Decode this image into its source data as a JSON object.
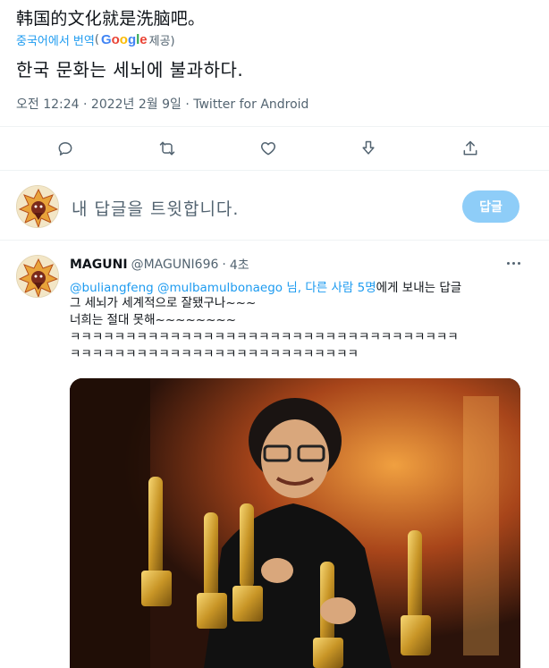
{
  "tweet": {
    "original_text": "韩国的文化就是洗脑吧。",
    "translate": {
      "link_label": "중국어에서 번역",
      "paren_open": "(",
      "google": [
        "G",
        "o",
        "o",
        "g",
        "l",
        "e"
      ],
      "suffix": " 제공)"
    },
    "translated_text": "한국 문화는 세뇌에 불과하다.",
    "meta": "오전 12:24 · 2022년 2월 9일 · Twitter for Android",
    "actions": [
      "reply-icon",
      "retweet-icon",
      "like-icon",
      "download-icon",
      "share-icon"
    ]
  },
  "reply_box": {
    "placeholder": "내 답글을 트윗합니다.",
    "button_label": "답글"
  },
  "reply_tweet": {
    "name": "MAGUNI",
    "handle": "@MAGUNI696",
    "dot": "·",
    "time": "4초",
    "replying_mentions": "@buliangfeng @mulbamulbonaego",
    "replying_others": "님, 다른 사람 5명",
    "replying_suffix": "에게 보내는 답글",
    "body": "그 세뇌가 세계적으로 잘됐구나~~~\n너희는 절대 못해~~~~~~~~\nㅋㅋㅋㅋㅋㅋㅋㅋㅋㅋㅋㅋㅋㅋㅋㅋㅋㅋㅋㅋㅋㅋㅋㅋㅋㅋㅋㅋㅋㅋㅋㅋㅋㅋㅋ\nㅋㅋㅋㅋㅋㅋㅋㅋㅋㅋㅋㅋㅋㅋㅋㅋㅋㅋㅋㅋㅋㅋㅋㅋㅋㅋ"
  },
  "colors": {
    "accent": "#1d9bf0",
    "muted": "#536471",
    "text": "#0f1419",
    "reply_button_disabled": "#8ecdf8",
    "divider": "#eff3f4"
  }
}
